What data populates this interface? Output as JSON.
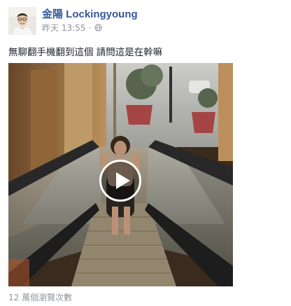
{
  "post": {
    "author": "金陽 Lockingyoung",
    "timestamp": "昨天 13:55",
    "separator": "·",
    "privacy_icon": "globe-icon",
    "message": "無聊翻手機翻到這個 請問這是在幹嘛",
    "video": {
      "play_icon": "play-icon"
    },
    "views": "12 萬個瀏覽次數"
  },
  "colors": {
    "author_link": "#365899",
    "meta_text": "#90949c",
    "body_text": "#1d2129"
  }
}
